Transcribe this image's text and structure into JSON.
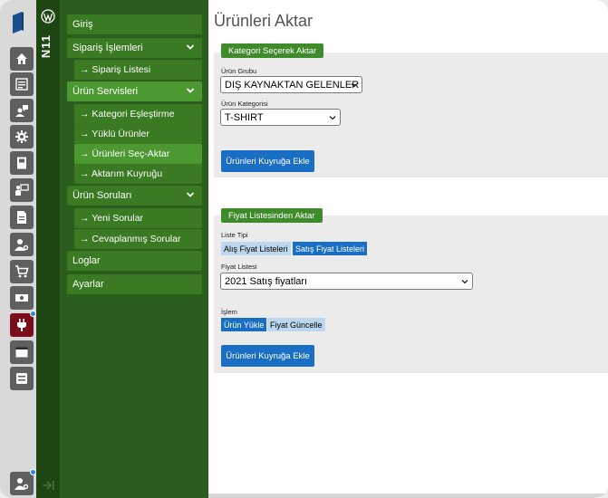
{
  "rail": {
    "icons": [
      "home-icon",
      "list-icon",
      "user-chat-icon",
      "gear-icon",
      "book-icon",
      "presenter-icon",
      "document-icon",
      "user-settings-icon",
      "cart-icon",
      "money-icon",
      "plug-icon",
      "window-icon",
      "settings-list-icon",
      "user-settings-icon"
    ]
  },
  "strip": {
    "brand": "N11"
  },
  "nav": {
    "home": "Giriş",
    "orders": "Sipariş İşlemleri",
    "order_list": "→ Sipariş Listesi",
    "product_services": "Ürün Servisleri",
    "category_match": "→ Kategori Eşleştirme",
    "loaded_products": "→ Yüklü Ürünler",
    "select_export": "→ Ürünleri Seç-Aktar",
    "export_queue": "→ Aktarım Kuyruğu",
    "product_questions": "Ürün Soruları",
    "new_questions": "→ Yeni Sorular",
    "answered_questions": "→ Cevaplanmış Sorular",
    "logs": "Loglar",
    "settings": "Ayarlar"
  },
  "main": {
    "title": "Ürünleri Aktar",
    "category_panel": {
      "tag": "Kategori Seçerek Aktar",
      "group_label": "Ürün Grubu",
      "group_value": "DIŞ KAYNAKTAN GELENLER",
      "category_label": "Ürün Kategorisi",
      "category_value": "T-SHIRT",
      "button": "Ürünleri Kuyruğa Ekle"
    },
    "price_panel": {
      "tag": "Fiyat Listesinden Aktar",
      "list_type_label": "Liste Tipi",
      "list_type_options": [
        "Alış Fiyat Listeleri",
        "Satış Fiyat Listeleri"
      ],
      "list_type_selected": "Satış Fiyat Listeleri",
      "price_list_label": "Fiyat Listesi",
      "price_list_value": "2021 Satış fiyatları",
      "operation_label": "İşlem",
      "operation_options": [
        "Ürün Yükle",
        "Fiyat Güncelle"
      ],
      "operation_selected": "Ürün Yükle",
      "button": "Ürünleri Kuyruğa Ekle"
    }
  },
  "colors": {
    "rail": "#d9d9d9",
    "strip": "#1e4613",
    "nav": "#2b5e1c",
    "nav_item": "#3a7a22",
    "nav_active": "#4c9931",
    "tag": "#3f8a2b",
    "button": "#1a6fc4",
    "active_rail_icon": "#7b0e1c"
  }
}
